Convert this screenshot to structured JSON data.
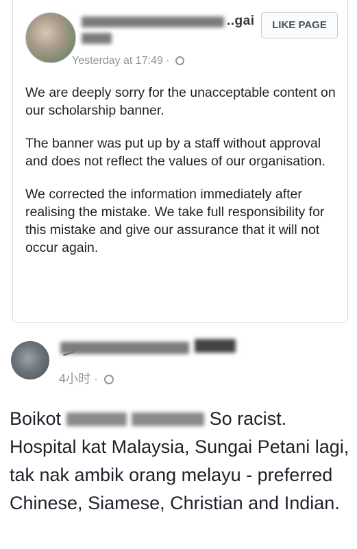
{
  "post1": {
    "page_name_tail": "..gai",
    "like_button": "LIKE PAGE",
    "timestamp": "Yesterday at 17:49 ·",
    "paragraphs": [
      "We are deeply sorry for the unacceptable content on our scholarship banner.",
      "The banner was put up by a staff without approval and does not reflect the values of our organisation.",
      "We corrected the information immediately after realising the mistake. We take full responsibility for this mistake and give our assurance that it will not occur again."
    ]
  },
  "post2": {
    "timestamp": "4小时 ·",
    "text_prefix": "Boikot",
    "text_suffix": "So racist. Hospital kat Malaysia, Sungai Petani lagi, tak nak ambik orang melayu - preferred Chinese, Siamese, Christian and Indian."
  }
}
